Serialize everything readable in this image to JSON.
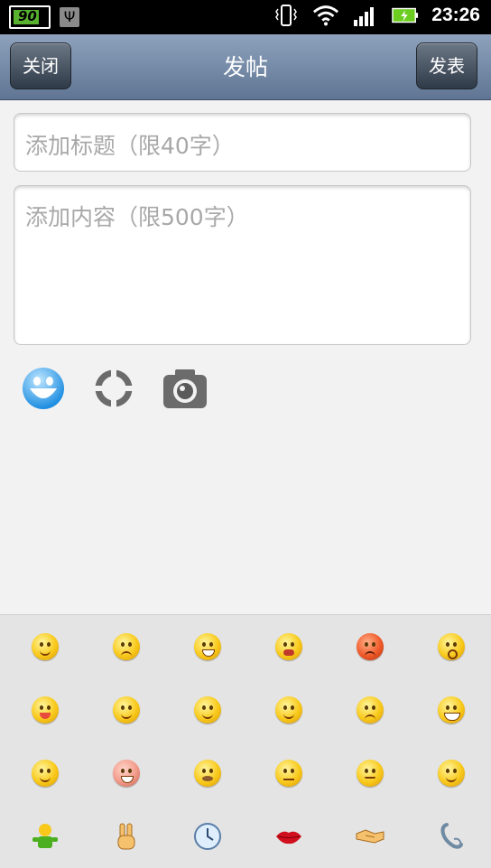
{
  "status_bar": {
    "battery_left_level": "90",
    "time": "23:26",
    "icons": [
      "battery-icon",
      "usb-icon",
      "vibrate-icon",
      "wifi-icon",
      "signal-icon",
      "charging-battery-icon"
    ]
  },
  "header": {
    "title": "发帖",
    "close_label": "关闭",
    "post_label": "发表"
  },
  "form": {
    "title_placeholder": "添加标题（限40字）",
    "content_placeholder": "添加内容（限500字）"
  },
  "toolbar": {
    "icons": [
      "emoji-icon",
      "location-icon",
      "camera-icon"
    ]
  },
  "emoji_panel": {
    "rows": [
      [
        "smile",
        "sad",
        "grin",
        "cry",
        "angry",
        "surprised"
      ],
      [
        "tongue",
        "love",
        "shy",
        "wink",
        "frown",
        "laugh"
      ],
      [
        "blush",
        "shock",
        "sick",
        "halo",
        "sealed-lips",
        "sleepy"
      ],
      [
        "person",
        "victory-hand",
        "clock",
        "lips",
        "handshake",
        "telephone"
      ]
    ]
  },
  "colors": {
    "header_top": "#8ea2bd",
    "header_bottom": "#5f7593",
    "background": "#f2f2f2",
    "emoji_panel": "#e4e4e4",
    "placeholder": "#a8a8a8"
  }
}
